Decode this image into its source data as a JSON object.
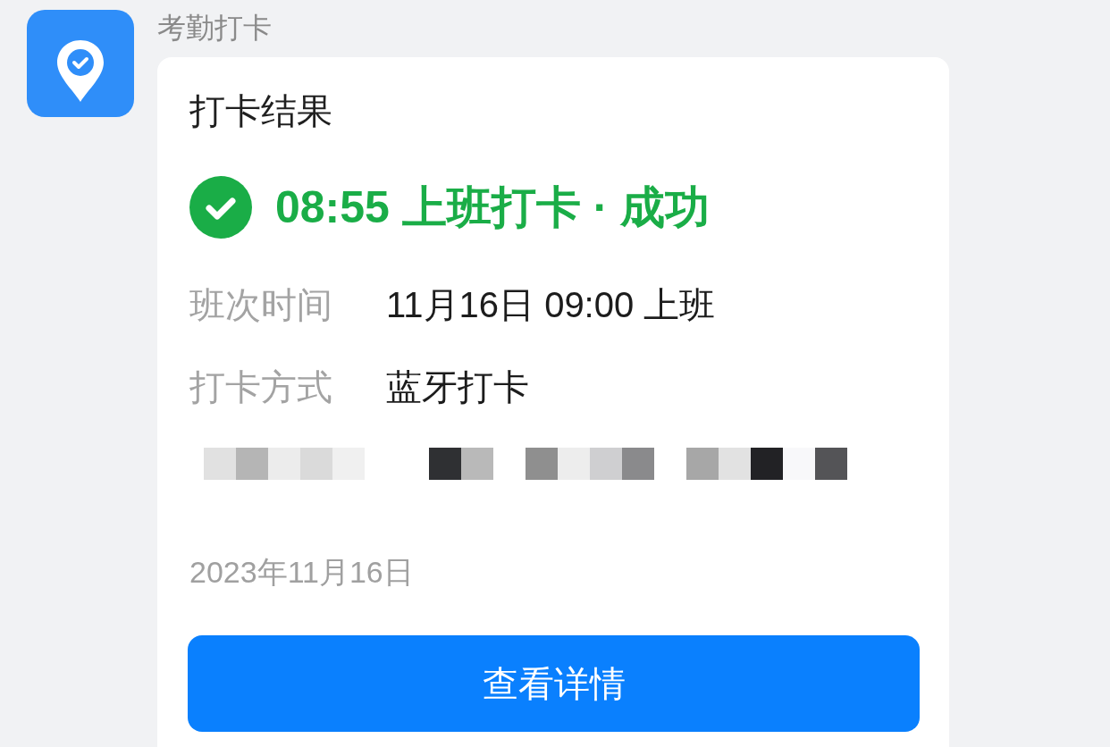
{
  "app": {
    "name": "考勤打卡"
  },
  "card": {
    "title": "打卡结果",
    "status": {
      "kind": "success",
      "text": "08:55 上班打卡 · 成功"
    },
    "fields": [
      {
        "label": "班次时间",
        "value": "11月16日 09:00 上班"
      },
      {
        "label": "打卡方式",
        "value": "蓝牙打卡"
      }
    ],
    "location_redacted": true,
    "date": "2023年11月16日",
    "button": {
      "label": "查看详情"
    }
  }
}
